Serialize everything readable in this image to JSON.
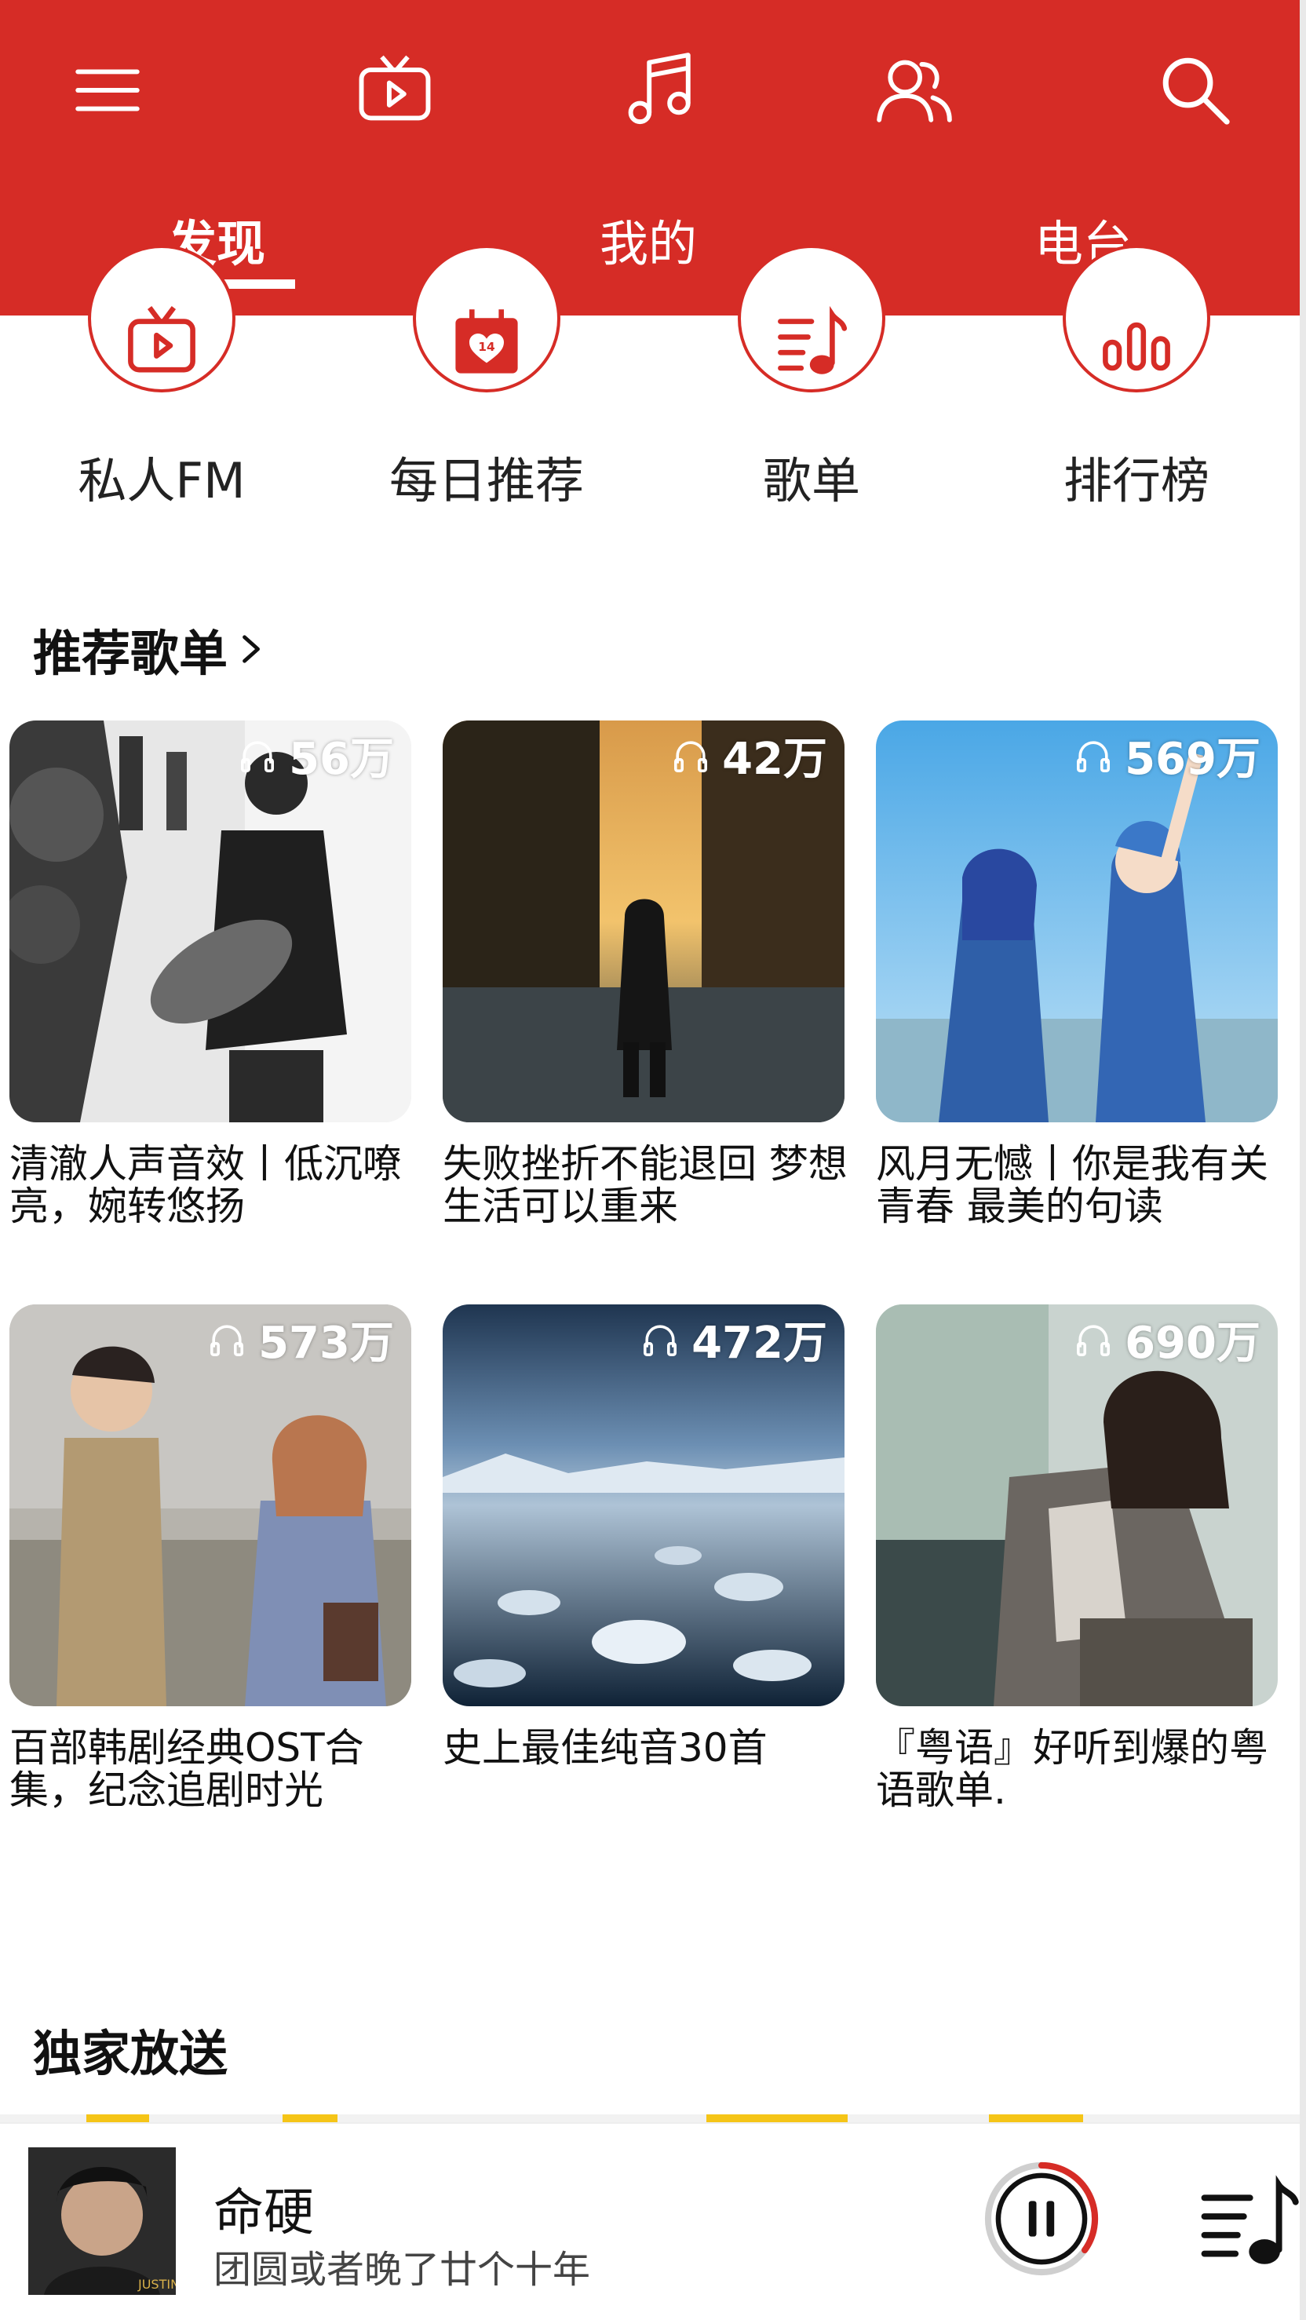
{
  "header": {
    "icons": [
      "menu-icon",
      "video-icon",
      "music-note-icon",
      "friends-icon",
      "search-icon"
    ],
    "tabs": [
      {
        "label": "发现",
        "active": true
      },
      {
        "label": "我的",
        "active": false
      },
      {
        "label": "电台",
        "active": false
      }
    ],
    "colors": {
      "brand": "#d62c26"
    }
  },
  "entries": [
    {
      "label": "私人FM",
      "icon": "radio-tv-icon"
    },
    {
      "label": "每日推荐",
      "icon": "calendar-heart-icon"
    },
    {
      "label": "歌单",
      "icon": "playlist-icon"
    },
    {
      "label": "排行榜",
      "icon": "chart-bars-icon"
    }
  ],
  "recommended": {
    "title": "推荐歌单",
    "playlists": [
      {
        "plays": "56万",
        "title": "清澈人声音效丨低沉嘹亮，婉转悠扬"
      },
      {
        "plays": "42万",
        "title": "失败挫折不能退回 梦想生活可以重来"
      },
      {
        "plays": "569万",
        "title": "风月无憾丨你是我有关青春 最美的句读"
      },
      {
        "plays": "573万",
        "title": "百部韩剧经典OST合集，纪念追剧时光"
      },
      {
        "plays": "472万",
        "title": "史上最佳纯音30首"
      },
      {
        "plays": "690万",
        "title": "『粤语』好听到爆的粤语歌单."
      }
    ]
  },
  "exclusive": {
    "title": "独家放送"
  },
  "player": {
    "song": "命硬",
    "subtitle": "团圆或者晚了廿个十年",
    "progress": 0.35
  }
}
